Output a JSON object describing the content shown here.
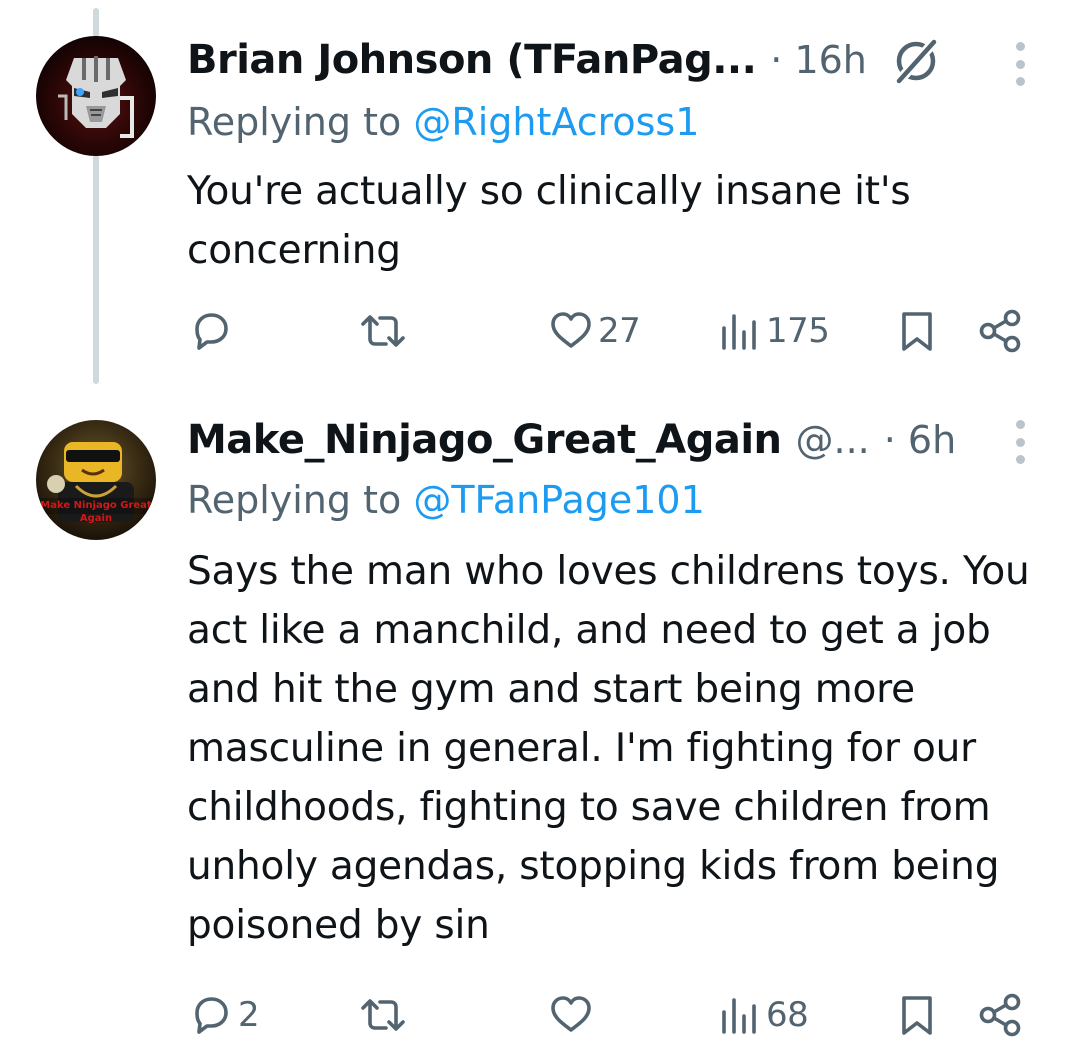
{
  "tweets": [
    {
      "display_name": "Brian Johnson (TFanPag...",
      "handle": "",
      "time": "· 16h",
      "replying_prefix": "Replying to ",
      "replying_to": "@RightAcross1",
      "text": "You're actually so clinically insane it's concerning",
      "replies": "",
      "retweets": "",
      "likes": "27",
      "views": "175"
    },
    {
      "display_name": "Make_Ninjago_Great_Again",
      "handle": "@...",
      "time": "· 6h",
      "replying_prefix": "Replying to ",
      "replying_to": "@TFanPage101",
      "text": "Says the man who loves childrens toys. You act like a manchild, and need to get a job and hit the gym and start being more masculine in general. I'm fighting for our childhoods, fighting to save children from unholy agendas, stopping kids from being poisoned by sin",
      "avatar_caption_1": "Make Ninjago Great",
      "avatar_caption_2": "Again",
      "replies": "2",
      "retweets": "",
      "likes": "",
      "views": "68"
    }
  ],
  "icons": {
    "reply": "reply-icon",
    "retweet": "retweet-icon",
    "like": "heart-icon",
    "views": "views-icon",
    "bookmark": "bookmark-icon",
    "share": "share-icon",
    "more": "more-icon",
    "grok": "grok-icon"
  },
  "colors": {
    "text_primary": "#0f1419",
    "text_secondary": "#536471",
    "mention": "#1d9bf0",
    "thread_line": "#cfd9de"
  }
}
